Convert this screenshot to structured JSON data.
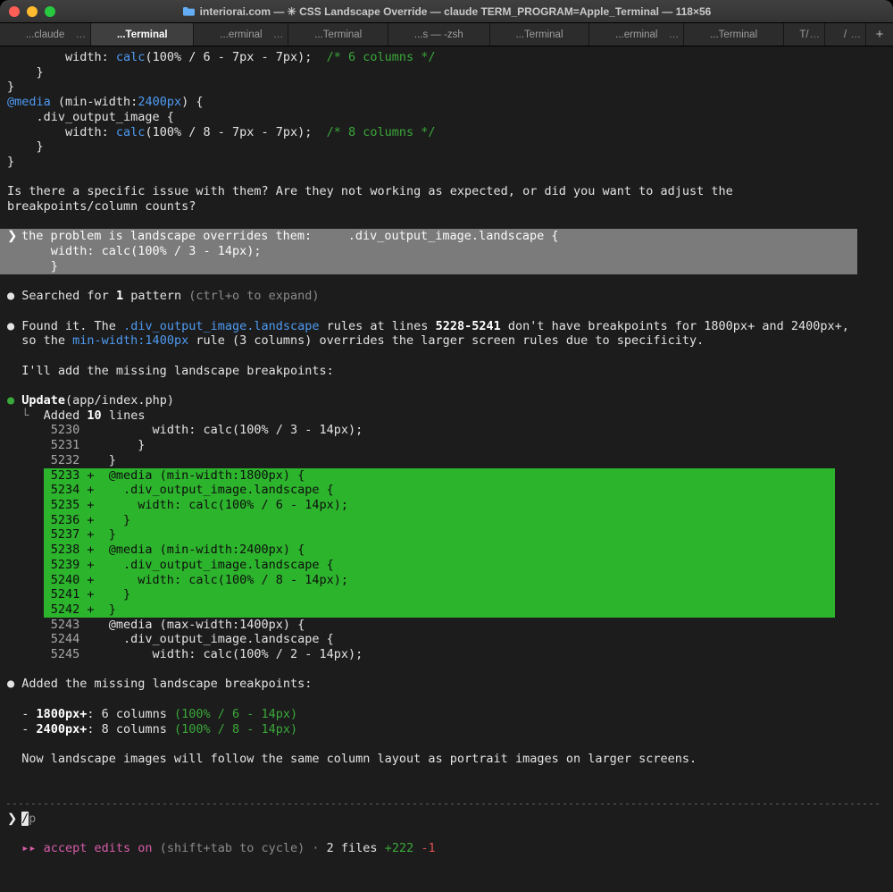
{
  "window": {
    "title": "interiorai.com — ✳ CSS Landscape Override — claude TERM_PROGRAM=Apple_Terminal — 118×56"
  },
  "tabs": {
    "new_tab_label": "+",
    "items": [
      {
        "label": "...claude",
        "active": false,
        "overflow": "…"
      },
      {
        "label": "...Terminal",
        "active": true
      },
      {
        "label": "...erminal",
        "active": false,
        "overflow": "…"
      },
      {
        "label": "...Terminal",
        "active": false
      },
      {
        "label": "...s — -zsh",
        "active": false
      },
      {
        "label": "...Terminal",
        "active": false
      },
      {
        "label": "...erminal",
        "active": false,
        "overflow": "…"
      },
      {
        "label": "...Terminal",
        "active": false
      },
      {
        "label": "T/",
        "active": false,
        "overflow": "…",
        "narrow": true
      },
      {
        "label": "/",
        "active": false,
        "overflow": "…",
        "narrow": true
      }
    ]
  },
  "colors": {
    "background": "#1c1c1c",
    "foreground": "#e3e3e3",
    "syntax_blue": "#4e9af1",
    "success_green": "#3aa83a",
    "diff_added_bg": "#2db42d",
    "user_block_bg": "#7b7b7b",
    "accent_magenta": "#d65ca8",
    "error_red": "#de5151"
  },
  "terminal": {
    "lines": [
      {
        "seg": [
          {
            "t": "        width: ",
            "c": "f"
          },
          {
            "t": "calc",
            "c": "b"
          },
          {
            "t": "(100% / 6 - 7px - 7px);  ",
            "c": "f"
          },
          {
            "t": "/* 6 columns */",
            "c": "g"
          }
        ]
      },
      {
        "seg": [
          {
            "t": "    }",
            "c": "f"
          }
        ]
      },
      {
        "seg": [
          {
            "t": "}",
            "c": "f"
          }
        ]
      },
      {
        "seg": [
          {
            "t": "@media",
            "c": "b"
          },
          {
            "t": " (min-width:",
            "c": "f"
          },
          {
            "t": "2400px",
            "c": "b"
          },
          {
            "t": ") {",
            "c": "f"
          }
        ]
      },
      {
        "seg": [
          {
            "t": "    .div_output_image {",
            "c": "f"
          }
        ]
      },
      {
        "seg": [
          {
            "t": "        width: ",
            "c": "f"
          },
          {
            "t": "calc",
            "c": "b"
          },
          {
            "t": "(100% / 8 - 7px - 7px);  ",
            "c": "f"
          },
          {
            "t": "/* 8 columns */",
            "c": "g"
          }
        ]
      },
      {
        "seg": [
          {
            "t": "    }",
            "c": "f"
          }
        ]
      },
      {
        "seg": [
          {
            "t": "}",
            "c": "f"
          }
        ]
      },
      {
        "seg": []
      },
      {
        "seg": [
          {
            "t": "Is there a specific issue with them? Are they not working as expected, or did you want to adjust the",
            "c": "f"
          }
        ]
      },
      {
        "seg": [
          {
            "t": "breakpoints/column counts?",
            "c": "f"
          }
        ]
      },
      {
        "seg": []
      },
      {
        "bg": "user",
        "name": "user-message-line",
        "seg": [
          {
            "t": "❯ ",
            "c": "pw"
          },
          {
            "t": "the problem is landscape overrides them:     .div_output_image.landscape {",
            "c": "uw"
          }
        ]
      },
      {
        "bg": "user",
        "name": "user-message-line",
        "seg": [
          {
            "t": "      width: calc(100% / 3 - 14px);",
            "c": "uw"
          }
        ]
      },
      {
        "bg": "user",
        "name": "user-message-line",
        "seg": [
          {
            "t": "      }",
            "c": "uw"
          }
        ]
      },
      {
        "seg": []
      },
      {
        "seg": [
          {
            "t": "● ",
            "c": "f"
          },
          {
            "t": "Searched for ",
            "c": "f"
          },
          {
            "t": "1",
            "c": "w"
          },
          {
            "t": " pattern ",
            "c": "f"
          },
          {
            "t": "(ctrl+o to expand)",
            "c": "d"
          }
        ]
      },
      {
        "seg": []
      },
      {
        "seg": [
          {
            "t": "● ",
            "c": "f"
          },
          {
            "t": "Found it. The ",
            "c": "f"
          },
          {
            "t": ".div_output_image.landscape",
            "c": "b"
          },
          {
            "t": " rules at lines ",
            "c": "f"
          },
          {
            "t": "5228-5241",
            "c": "w"
          },
          {
            "t": " don't have breakpoints for ",
            "c": "f"
          },
          {
            "t": "1800px+",
            "c": "f"
          },
          {
            "t": " and ",
            "c": "f"
          },
          {
            "t": "2400px+",
            "c": "f"
          },
          {
            "t": ",",
            "c": "f"
          }
        ]
      },
      {
        "seg": [
          {
            "t": "  so the ",
            "c": "f"
          },
          {
            "t": "min-width:1400px",
            "c": "b"
          },
          {
            "t": " rule (3 columns) overrides the larger screen rules due to specificity.",
            "c": "f"
          }
        ]
      },
      {
        "seg": []
      },
      {
        "seg": [
          {
            "t": "  I'll add the missing landscape breakpoints:",
            "c": "f"
          }
        ]
      },
      {
        "seg": []
      },
      {
        "seg": [
          {
            "t": "● ",
            "c": "g"
          },
          {
            "t": "Update",
            "c": "w"
          },
          {
            "t": "(app/index.php)",
            "c": "f"
          }
        ]
      },
      {
        "seg": [
          {
            "t": "  └  ",
            "c": "d"
          },
          {
            "t": "Added ",
            "c": "f"
          },
          {
            "t": "10",
            "c": "w"
          },
          {
            "t": " lines",
            "c": "f"
          }
        ]
      },
      {
        "seg": [
          {
            "t": "      5230",
            "c": "n"
          },
          {
            "t": "          width: calc(100% / 3 - 14px);",
            "c": "f"
          }
        ]
      },
      {
        "seg": [
          {
            "t": "      5231",
            "c": "n"
          },
          {
            "t": "        }",
            "c": "f"
          }
        ]
      },
      {
        "seg": [
          {
            "t": "      5232",
            "c": "n"
          },
          {
            "t": "    }",
            "c": "f"
          }
        ]
      },
      {
        "added": true,
        "name": "diff-added-line",
        "text": " 5233 +  @media (min-width:1800px) {"
      },
      {
        "added": true,
        "name": "diff-added-line",
        "text": " 5234 +    .div_output_image.landscape {"
      },
      {
        "added": true,
        "name": "diff-added-line",
        "text": " 5235 +      width: calc(100% / 6 - 14px);"
      },
      {
        "added": true,
        "name": "diff-added-line",
        "text": " 5236 +    }"
      },
      {
        "added": true,
        "name": "diff-added-line",
        "text": " 5237 +  }"
      },
      {
        "added": true,
        "name": "diff-added-line",
        "text": " 5238 +  @media (min-width:2400px) {"
      },
      {
        "added": true,
        "name": "diff-added-line",
        "text": " 5239 +    .div_output_image.landscape {"
      },
      {
        "added": true,
        "name": "diff-added-line",
        "text": " 5240 +      width: calc(100% / 8 - 14px);"
      },
      {
        "added": true,
        "name": "diff-added-line",
        "text": " 5241 +    }"
      },
      {
        "added": true,
        "name": "diff-added-line",
        "text": " 5242 +  }"
      },
      {
        "seg": [
          {
            "t": "      5243",
            "c": "n"
          },
          {
            "t": "    @media (max-width:1400px) {",
            "c": "f"
          }
        ]
      },
      {
        "seg": [
          {
            "t": "      5244",
            "c": "n"
          },
          {
            "t": "      .div_output_image.landscape {",
            "c": "f"
          }
        ]
      },
      {
        "seg": [
          {
            "t": "      5245",
            "c": "n"
          },
          {
            "t": "          width: calc(100% / 2 - 14px);",
            "c": "f"
          }
        ]
      },
      {
        "seg": []
      },
      {
        "seg": [
          {
            "t": "● ",
            "c": "f"
          },
          {
            "t": "Added the missing landscape breakpoints:",
            "c": "f"
          }
        ]
      },
      {
        "seg": []
      },
      {
        "seg": [
          {
            "t": "  - ",
            "c": "f"
          },
          {
            "t": "1800px+",
            "c": "w"
          },
          {
            "t": ": 6 columns ",
            "c": "f"
          },
          {
            "t": "(100% / 6 - 14px)",
            "c": "g"
          }
        ]
      },
      {
        "seg": [
          {
            "t": "  - ",
            "c": "f"
          },
          {
            "t": "2400px+",
            "c": "w"
          },
          {
            "t": ": 8 columns ",
            "c": "f"
          },
          {
            "t": "(100% / 8 - 14px)",
            "c": "g"
          }
        ]
      },
      {
        "seg": []
      },
      {
        "seg": [
          {
            "t": "  Now landscape images will follow the same column layout as portrait images on larger screens.",
            "c": "f"
          }
        ]
      },
      {
        "seg": []
      },
      {
        "seg": []
      },
      {
        "type": "hr",
        "name": "input-separator"
      },
      {
        "input": true,
        "name": "command-input-line",
        "seg": [
          {
            "t": "❯ ",
            "c": "pb"
          },
          {
            "t": "/",
            "c": "cur"
          },
          {
            "t": "p",
            "c": "d"
          }
        ]
      },
      {
        "seg": []
      },
      {
        "name": "status-line",
        "seg": [
          {
            "t": "  ",
            "c": "f"
          },
          {
            "t": "▸▸ accept edits on ",
            "c": "m"
          },
          {
            "t": "(shift+tab to cycle)",
            "c": "d"
          },
          {
            "t": " · ",
            "c": "d"
          },
          {
            "t": "2 files ",
            "c": "f"
          },
          {
            "t": "+222",
            "c": "g"
          },
          {
            "t": " ",
            "c": "f"
          },
          {
            "t": "-1",
            "c": "r"
          }
        ]
      }
    ]
  }
}
